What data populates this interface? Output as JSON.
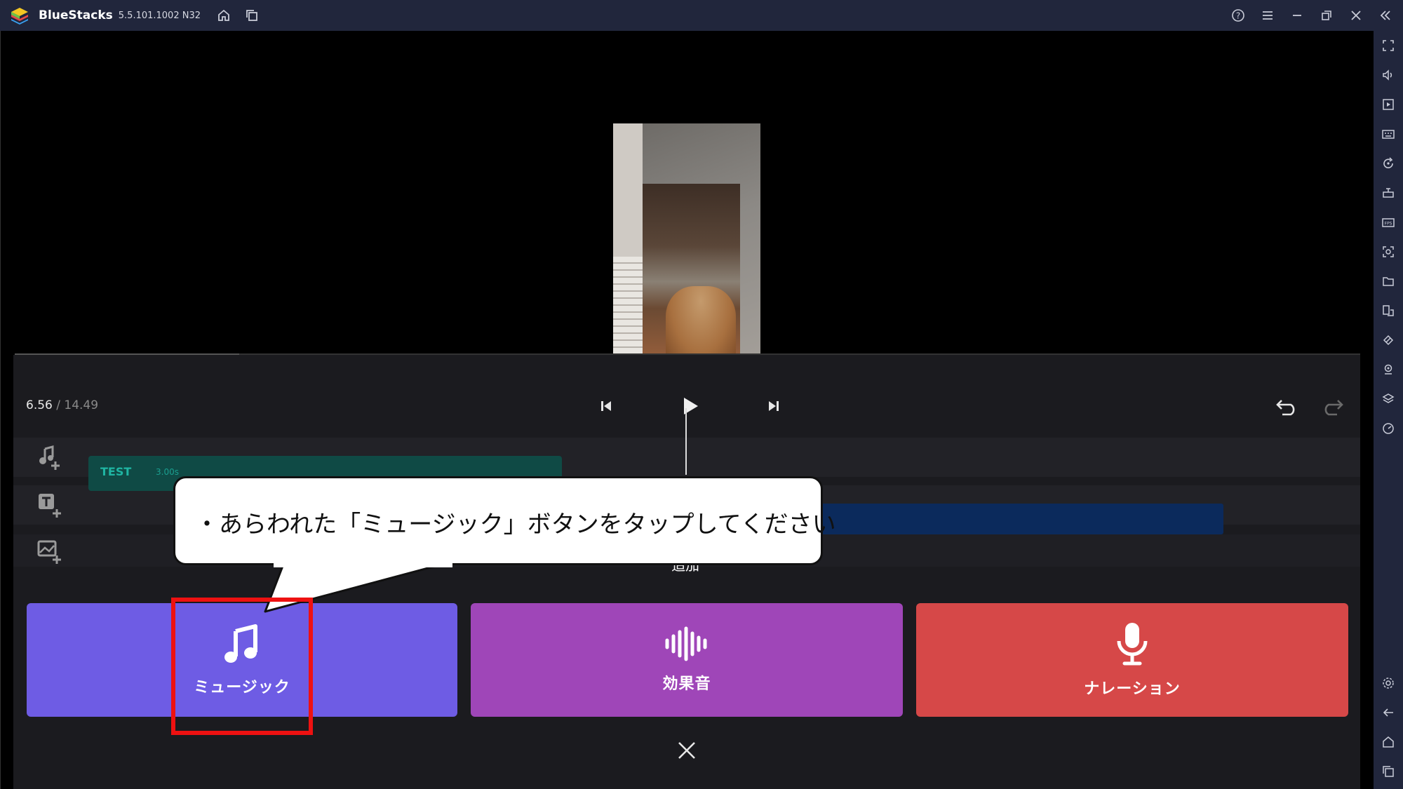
{
  "app": {
    "name": "BlueStacks",
    "version": "5.5.101.1002  N32"
  },
  "editor": {
    "time_current": "6.56",
    "time_total": "/ 14.49",
    "text_clip": {
      "label": "TEST",
      "duration": "3.00s"
    }
  },
  "add_sheet": {
    "title": "追加",
    "music_label": "ミュージック",
    "sfx_label": "効果音",
    "narration_label": "ナレーション"
  },
  "callout": {
    "text": "・あらわれた「ミュージック」ボタンをタップしてください"
  },
  "colors": {
    "music_tile": "#6e5ce4",
    "sfx_tile": "#9f46b8",
    "narration_tile": "#d64848",
    "text_clip": "#0f4a45",
    "image_clip": "#0b2a5c",
    "highlight": "#ee1111"
  },
  "icons": {
    "titlebar": [
      "home-icon",
      "multi-instance-icon",
      "help-icon",
      "menu-icon",
      "minimize-icon",
      "restore-icon",
      "close-icon",
      "collapse-sidebar-icon"
    ],
    "sidebar": [
      "fullscreen-icon",
      "volume-icon",
      "media-icon",
      "keyboard-icon",
      "rotate-icon",
      "macro-icon",
      "fps-icon",
      "screenshot-icon",
      "folder-icon",
      "multi-window-icon",
      "eco-icon",
      "location-icon",
      "layers-icon",
      "performance-icon",
      "settings-icon",
      "back-icon",
      "home-icon",
      "recents-icon"
    ]
  }
}
